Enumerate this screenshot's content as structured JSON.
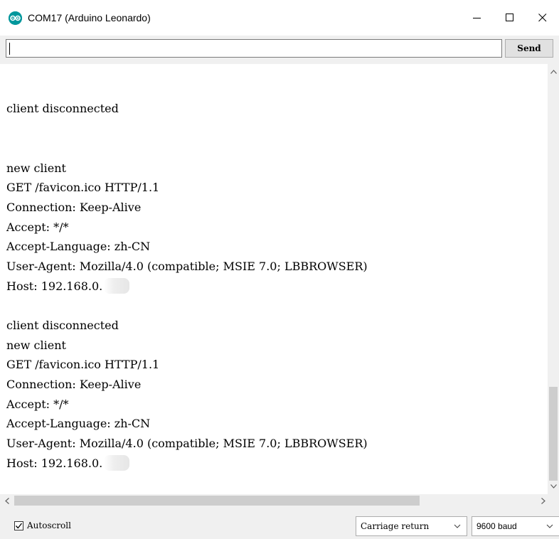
{
  "window": {
    "title": "COM17 (Arduino Leonardo)",
    "icon": "arduino-logo-icon",
    "accent_color": "#00979c"
  },
  "send": {
    "input_value": "",
    "button_label": "Send"
  },
  "output": {
    "partial_top_line": "client disconnected",
    "lines": [
      "new client",
      "GET /favicon.ico HTTP/1.1",
      "Connection: Keep-Alive",
      "Accept: */*",
      "Accept-Language: zh-CN",
      "User-Agent: Mozilla/4.0 (compatible; MSIE 7.0; LBBROWSER)",
      "Host: 192.168.0.",
      "",
      "client disconnected",
      "new client",
      "GET /favicon.ico HTTP/1.1",
      "Connection: Keep-Alive",
      "Accept: */*",
      "Accept-Language: zh-CN",
      "User-Agent: Mozilla/4.0 (compatible; MSIE 7.0; LBBROWSER)",
      "Host: 192.168.0.",
      "",
      "client disconnected"
    ]
  },
  "status": {
    "autoscroll_label": "Autoscroll",
    "autoscroll_checked": true,
    "line_ending": "Carriage return",
    "baud_rate": "9600 baud"
  }
}
